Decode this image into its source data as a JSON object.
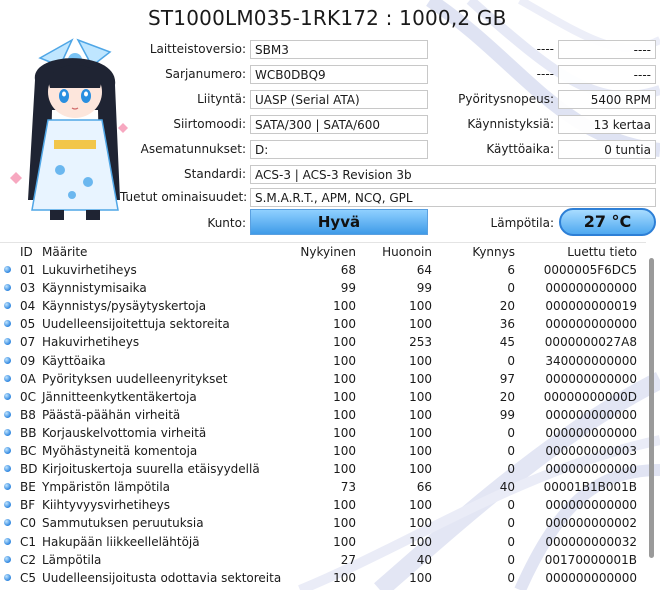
{
  "window": {
    "title": "ST1000LM035-1RK172 : 1000,2 GB"
  },
  "info": {
    "firmware_label": "Laitteistoversio:",
    "firmware": "SBM3",
    "serial_label": "Sarjanumero:",
    "serial": "WCB0DBQ9",
    "interface_label": "Liityntä:",
    "interface": "UASP (Serial ATA)",
    "transfer_label": "Siirtomoodi:",
    "transfer": "SATA/300 | SATA/600",
    "drive_letter_label": "Asematunnukset:",
    "drive_letter": "D:",
    "standard_label": "Standardi:",
    "standard": "ACS-3 | ACS-3 Revision 3b",
    "features_label": "Tuetut ominaisuudet:",
    "features": "S.M.A.R.T., APM, NCQ, GPL",
    "right1_label": "----",
    "right1_value": "----",
    "right2_label": "----",
    "right2_value": "----",
    "rotation_label": "Pyöritysnopeus:",
    "rotation": "5400 RPM",
    "power_count_label": "Käynnistyksiä:",
    "power_count": "13 kertaa",
    "power_hours_label": "Käyttöaika:",
    "power_hours": "0 tuntia"
  },
  "health": {
    "label": "Kunto:",
    "status": "Hyvä",
    "status_color": "#4aa3ea"
  },
  "temperature": {
    "label": "Lämpötila:",
    "value": "27 °C",
    "color": "#4ea8f0"
  },
  "table": {
    "headers": {
      "id": "ID",
      "name": "Määrite",
      "current": "Nykyinen",
      "worst": "Huonoin",
      "threshold": "Kynnys",
      "raw": "Luettu tieto"
    },
    "rows": [
      {
        "id": "01",
        "name": "Lukuvirhetiheys",
        "current": "68",
        "worst": "64",
        "threshold": "6",
        "raw": "0000005F6DC5"
      },
      {
        "id": "03",
        "name": "Käynnistymisaika",
        "current": "99",
        "worst": "99",
        "threshold": "0",
        "raw": "000000000000"
      },
      {
        "id": "04",
        "name": "Käynnistys/pysäytyskertoja",
        "current": "100",
        "worst": "100",
        "threshold": "20",
        "raw": "000000000019"
      },
      {
        "id": "05",
        "name": "Uudelleensijoitettuja sektoreita",
        "current": "100",
        "worst": "100",
        "threshold": "36",
        "raw": "000000000000"
      },
      {
        "id": "07",
        "name": "Hakuvirhetiheys",
        "current": "100",
        "worst": "253",
        "threshold": "45",
        "raw": "0000000027A8"
      },
      {
        "id": "09",
        "name": "Käyttöaika",
        "current": "100",
        "worst": "100",
        "threshold": "0",
        "raw": "340000000000"
      },
      {
        "id": "0A",
        "name": "Pyörityksen uudelleenyritykset",
        "current": "100",
        "worst": "100",
        "threshold": "97",
        "raw": "000000000000"
      },
      {
        "id": "0C",
        "name": "Jännitteenkytkentäkertoja",
        "current": "100",
        "worst": "100",
        "threshold": "20",
        "raw": "00000000000D"
      },
      {
        "id": "B8",
        "name": "Päästä-päähän virheitä",
        "current": "100",
        "worst": "100",
        "threshold": "99",
        "raw": "000000000000"
      },
      {
        "id": "BB",
        "name": "Korjauskelvottomia virheitä",
        "current": "100",
        "worst": "100",
        "threshold": "0",
        "raw": "000000000000"
      },
      {
        "id": "BC",
        "name": "Myöhästyneitä komentoja",
        "current": "100",
        "worst": "100",
        "threshold": "0",
        "raw": "000000000003"
      },
      {
        "id": "BD",
        "name": "Kirjoituskertoja suurella etäisyydellä",
        "current": "100",
        "worst": "100",
        "threshold": "0",
        "raw": "000000000000"
      },
      {
        "id": "BE",
        "name": "Ympäristön lämpötila",
        "current": "73",
        "worst": "66",
        "threshold": "40",
        "raw": "00001B1B001B"
      },
      {
        "id": "BF",
        "name": "Kiihtyvyysvirhetiheys",
        "current": "100",
        "worst": "100",
        "threshold": "0",
        "raw": "000000000000"
      },
      {
        "id": "C0",
        "name": "Sammutuksen peruutuksia",
        "current": "100",
        "worst": "100",
        "threshold": "0",
        "raw": "000000000002"
      },
      {
        "id": "C1",
        "name": "Hakupään liikkeellelähtöjä",
        "current": "100",
        "worst": "100",
        "threshold": "0",
        "raw": "000000000032"
      },
      {
        "id": "C2",
        "name": "Lämpötila",
        "current": "27",
        "worst": "40",
        "threshold": "0",
        "raw": "00170000001B"
      },
      {
        "id": "C5",
        "name": "Uudelleensijoitusta odottavia sektoreita",
        "current": "100",
        "worst": "100",
        "threshold": "0",
        "raw": "000000000000"
      }
    ]
  }
}
